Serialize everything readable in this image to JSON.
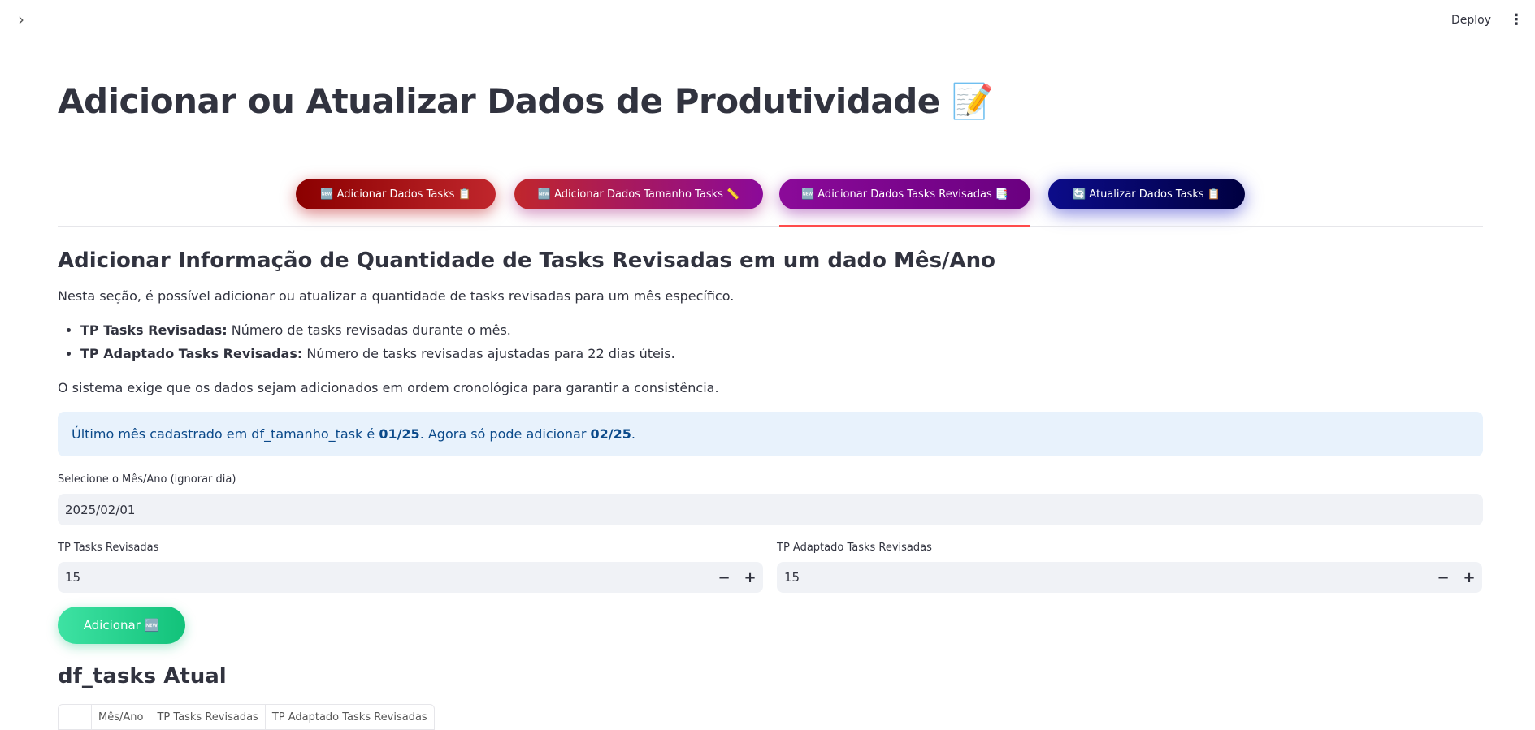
{
  "topbar": {
    "deploy_label": "Deploy",
    "sidebar_toggle": "›",
    "menu_icon": "⋮"
  },
  "page": {
    "title": "Adicionar ou Atualizar Dados de Produtividade 📝"
  },
  "tabs": [
    {
      "label": "🆕 Adicionar Dados Tasks 📋"
    },
    {
      "label": "🆕 Adicionar Dados Tamanho Tasks 📏"
    },
    {
      "label": "🆕 Adicionar Dados Tasks Revisadas 📑",
      "active": true
    },
    {
      "label": "🔄 Atualizar Dados Tasks 📋"
    }
  ],
  "section": {
    "title": "Adicionar Informação de Quantidade de Tasks Revisadas em um dado Mês/Ano",
    "intro": "Nesta seção, é possível adicionar ou atualizar a quantidade de tasks revisadas para um mês específico.",
    "bullets": [
      {
        "term": "TP Tasks Revisadas:",
        "text": " Número de tasks revisadas durante o mês."
      },
      {
        "term": "TP Adaptado Tasks Revisadas:",
        "text": " Número de tasks revisadas ajustadas para 22 dias úteis."
      }
    ],
    "note": "O sistema exige que os dados sejam adicionados em ordem cronológica para garantir a consistência."
  },
  "info": {
    "prefix": "Último mês cadastrado em df_tamanho_task é ",
    "last_month": "01/25",
    "middle": ". Agora só pode adicionar ",
    "next_month": "02/25",
    "suffix": "."
  },
  "form": {
    "date_label": "Selecione o Mês/Ano (ignorar dia)",
    "date_value": "2025/02/01",
    "tp_label": "TP Tasks Revisadas",
    "tp_value": "15",
    "tpa_label": "TP Adaptado Tasks Revisadas",
    "tpa_value": "15",
    "minus": "−",
    "plus": "+",
    "add_button": "Adicionar 🆕"
  },
  "df": {
    "title": "df_tasks Atual",
    "columns": [
      "Mês/Ano",
      "TP Tasks Revisadas",
      "TP Adaptado Tasks Revisadas"
    ]
  },
  "colors": {
    "accent": "#ff4b4b",
    "info_bg": "#e8f2fc",
    "info_text": "#0b4a8a",
    "button_green": "#12c27a"
  }
}
